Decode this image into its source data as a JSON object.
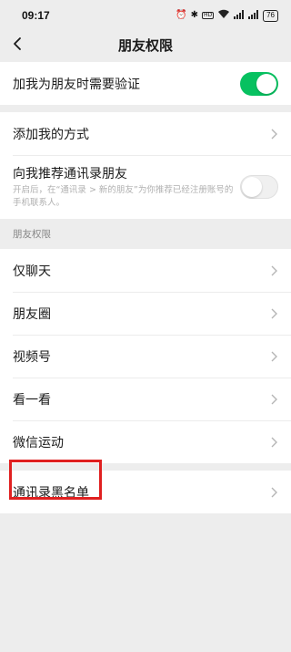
{
  "status_bar": {
    "time": "09:17",
    "battery": "76",
    "icons": [
      "alarm-icon",
      "bluetooth-icon",
      "hd-icon",
      "wifi-icon",
      "signal-icon",
      "signal-icon"
    ]
  },
  "nav": {
    "title": "朋友权限"
  },
  "settings": {
    "verify_label": "加我为朋友时需要验证",
    "verify_on": true,
    "add_method_label": "添加我的方式",
    "recommend_label": "向我推荐通讯录朋友",
    "recommend_desc": "开启后，在“通讯录 > 新的朋友”为你推荐已经注册账号的手机联系人。",
    "recommend_on": false
  },
  "friend_permissions": {
    "header": "朋友权限",
    "items": [
      "仅聊天",
      "朋友圈",
      "视频号",
      "看一看",
      "微信运动"
    ]
  },
  "blacklist": {
    "label": "通讯录黑名单"
  },
  "colors": {
    "accent": "#07c160",
    "highlight": "#e02020"
  }
}
